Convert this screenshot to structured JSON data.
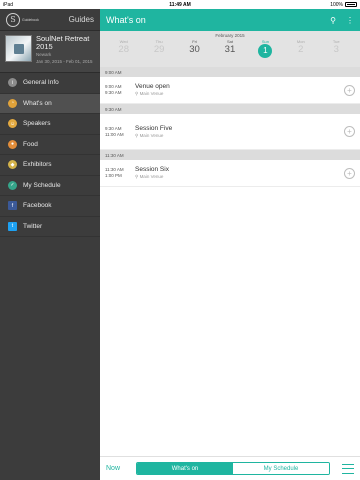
{
  "status": {
    "left": "iPad",
    "time": "11:49 AM",
    "battery": "100%"
  },
  "sidebar": {
    "logo_text": "Guidebook",
    "guides_label": "Guides",
    "event": {
      "title": "SoulNet Retreat 2015",
      "location": "Newark",
      "dates": "Jan 30, 2015 - Feb 01, 2015"
    },
    "items": [
      {
        "label": "General Info",
        "icon": "info-icon",
        "color": "#8c8c8c"
      },
      {
        "label": "What's on",
        "icon": "calendar-icon",
        "color": "#e0a23a"
      },
      {
        "label": "Speakers",
        "icon": "person-icon",
        "color": "#e3a940"
      },
      {
        "label": "Food",
        "icon": "food-icon",
        "color": "#e28d3a"
      },
      {
        "label": "Exhibitors",
        "icon": "exhibitors-icon",
        "color": "#d3b24a"
      },
      {
        "label": "My Schedule",
        "icon": "schedule-icon",
        "color": "#35a58a"
      },
      {
        "label": "Facebook",
        "icon": "facebook-icon",
        "color": "#3b5998"
      },
      {
        "label": "Twitter",
        "icon": "twitter-icon",
        "color": "#1da1f2"
      }
    ]
  },
  "main": {
    "title": "What's on",
    "calendar": {
      "month": "February 2015",
      "days": [
        {
          "dow": "Wed",
          "num": "28"
        },
        {
          "dow": "Thu",
          "num": "29"
        },
        {
          "dow": "Fri",
          "num": "30"
        },
        {
          "dow": "Sat",
          "num": "31"
        },
        {
          "dow": "Sun",
          "num": "1"
        },
        {
          "dow": "Mon",
          "num": "2"
        },
        {
          "dow": "Tue",
          "num": "3"
        }
      ]
    },
    "groups": [
      {
        "header": "9:00 AM",
        "sessions": [
          {
            "start": "9:00 AM",
            "end": "9:30 AM",
            "title": "Venue open",
            "venue": "Main Venue"
          }
        ]
      },
      {
        "header": "9:30 AM",
        "sessions": [
          {
            "start": "9:30 AM",
            "end": "11:00 AM",
            "title": "Session Five",
            "venue": "Main Venue"
          }
        ]
      },
      {
        "header": "11:30 AM",
        "sessions": [
          {
            "start": "11:30 AM",
            "end": "1:00 PM",
            "title": "Session Six",
            "venue": "Main Venue"
          }
        ]
      }
    ],
    "bottom": {
      "now": "Now",
      "tab_whats_on": "What's on",
      "tab_my_schedule": "My Schedule"
    }
  },
  "colors": {
    "accent": "#1fb5a0",
    "sidebar_bg": "#3c3c3c"
  }
}
